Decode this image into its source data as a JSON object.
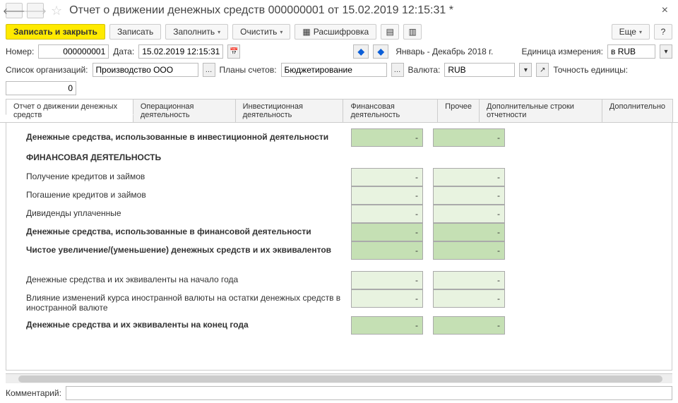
{
  "title": "Отчет о движении денежных средств 000000001 от 15.02.2019 12:15:31 *",
  "toolbar": {
    "save_close": "Записать и закрыть",
    "save": "Записать",
    "fill": "Заполнить",
    "clear": "Очистить",
    "decode": "Расшифровка",
    "more": "Еще"
  },
  "fields": {
    "number_label": "Номер:",
    "number": "000000001",
    "date_label": "Дата:",
    "date": "15.02.2019 12:15:31",
    "period": "Январь - Декабрь 2018 г.",
    "unit_label": "Единица измерения:",
    "unit": "в RUB",
    "orgs_label": "Список организаций:",
    "orgs": "Производство ООО",
    "plans_label": "Планы счетов:",
    "plans": "Бюджетирование",
    "currency_label": "Валюта:",
    "currency": "RUB",
    "precision_label": "Точность единицы:",
    "precision": "0"
  },
  "tabs": [
    "Отчет о движении денежных средств",
    "Операционная деятельность",
    "Инвестиционная деятельность",
    "Финансовая деятельность",
    "Прочее",
    "Дополнительные строки отчетности",
    "Дополнительно"
  ],
  "rows": [
    {
      "label": "Денежные средства, использованные в инвестиционной деятельности",
      "bold": true,
      "v1": "-",
      "v2": "-",
      "dark": true
    },
    {
      "label": "ФИНАНСОВАЯ ДЕЯТЕЛЬНОСТЬ",
      "section": true
    },
    {
      "label": "Получение кредитов и займов",
      "v1": "-",
      "v2": "-"
    },
    {
      "label": "Погашение кредитов и займов",
      "v1": "-",
      "v2": "-"
    },
    {
      "label": "Дивиденды уплаченные",
      "v1": "-",
      "v2": "-"
    },
    {
      "label": "Денежные средства, использованные в финансовой деятельности",
      "bold": true,
      "v1": "-",
      "v2": "-",
      "dark": true
    },
    {
      "label": "Чистое увеличение/(уменьшение) денежных средств и их эквивалентов",
      "bold": true,
      "v1": "-",
      "v2": "-",
      "dark": true
    },
    {
      "label": "",
      "section": true
    },
    {
      "label": "Денежные средства и их эквиваленты на начало года",
      "v1": "-",
      "v2": "-"
    },
    {
      "label": "Влияние изменений курса иностранной валюты на остатки денежных средств в иностранной валюте",
      "v1": "-",
      "v2": "-"
    },
    {
      "label": "Денежные средства и их эквиваленты на конец года",
      "bold": true,
      "v1": "-",
      "v2": "-",
      "dark": true
    }
  ],
  "footer": {
    "comment_label": "Комментарий:",
    "comment": ""
  }
}
